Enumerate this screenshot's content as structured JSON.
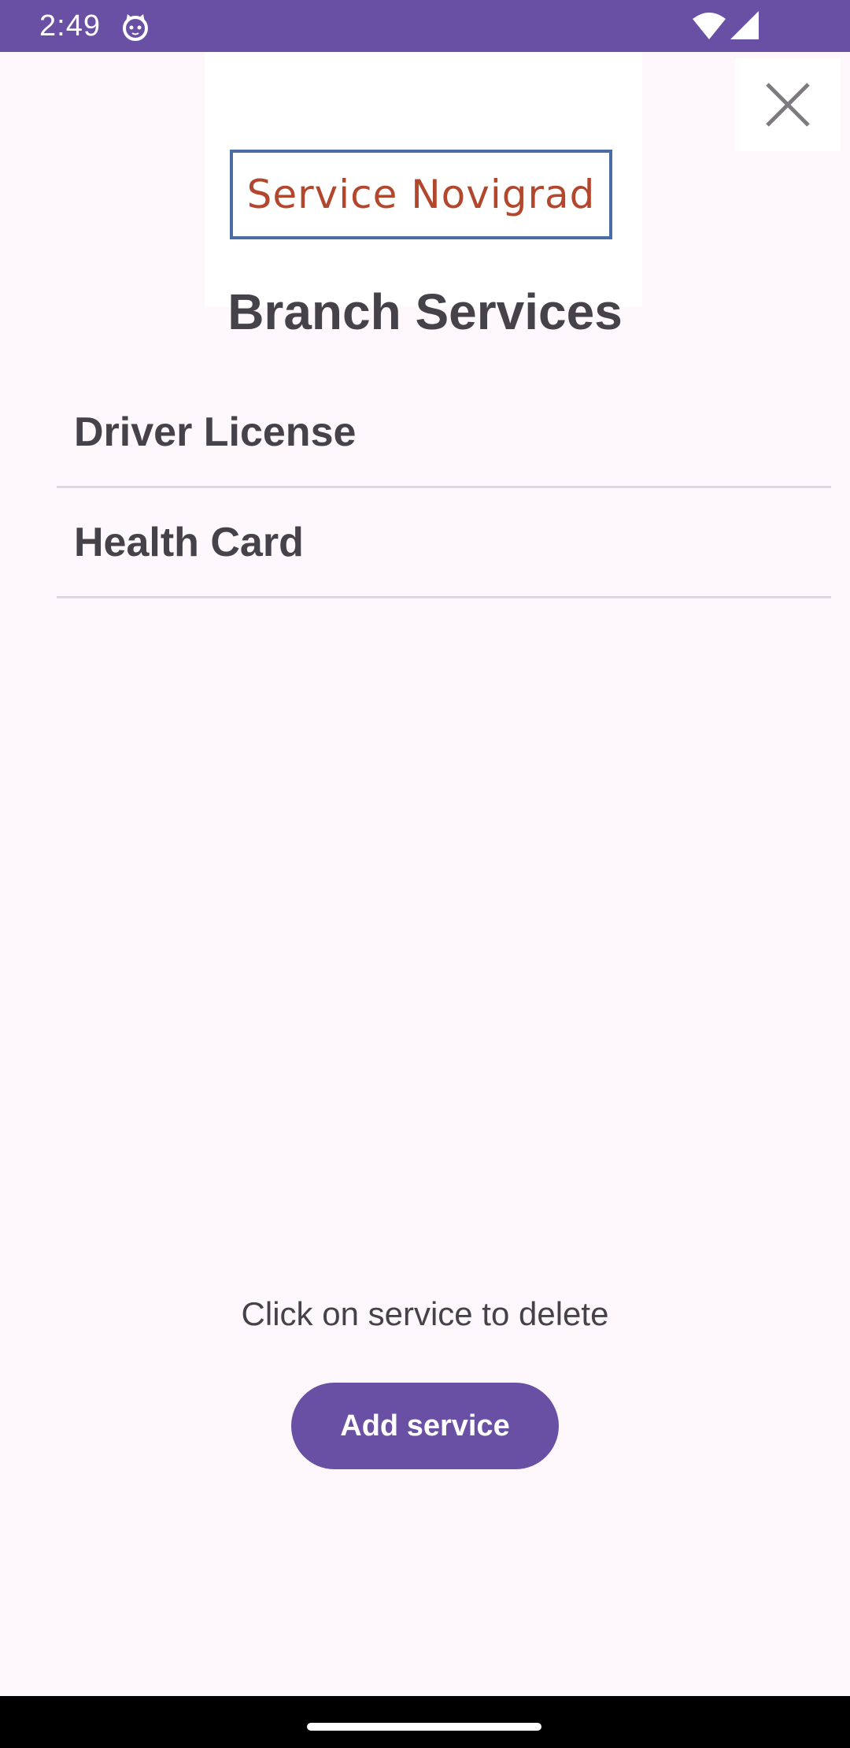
{
  "status_bar": {
    "time": "2:49",
    "color": "#6a50a4"
  },
  "logo": {
    "text": "Service Novigrad",
    "text_color": "#b3472d",
    "border_color": "#4b6ca4"
  },
  "page": {
    "title": "Branch Services"
  },
  "services": [
    {
      "label": "Driver License"
    },
    {
      "label": "Health Card"
    }
  ],
  "hint": "Click on service to delete",
  "add_button": {
    "label": "Add service",
    "color": "#6a50a4"
  },
  "icons": {
    "status": [
      "cat-icon",
      "wifi-icon",
      "signal-icon"
    ],
    "close": "close-icon"
  }
}
